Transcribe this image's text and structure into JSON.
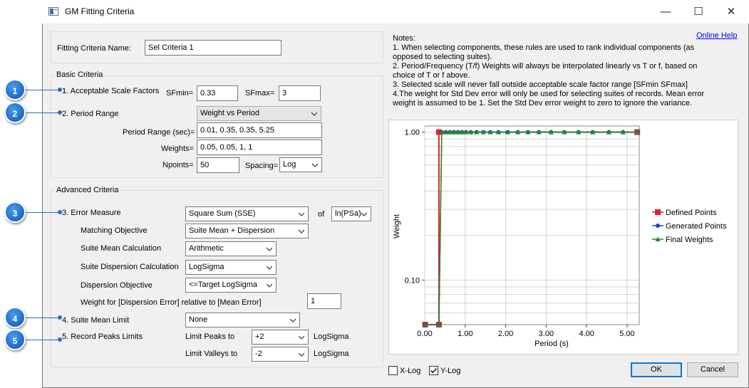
{
  "window": {
    "title": "GM Fitting Criteria",
    "minimize_glyph": "—",
    "maximize_glyph": "☐",
    "close_glyph": "✕"
  },
  "fitting_criteria_name": {
    "label": "Fitting Criteria Name:",
    "value": "Sel Criteria 1"
  },
  "basic": {
    "title": "Basic Criteria",
    "scale_factors_label": "1. Acceptable Scale Factors",
    "sfmin_label": "SFmin=",
    "sfmin_value": "0.33",
    "sfmax_label": "SFmax=",
    "sfmax_value": "3",
    "period_range_label": "2. Period Range",
    "period_mode": "Weight vs Period",
    "period_range_sec_label": "Period Range (sec)=",
    "period_range_sec_value": "0.01, 0.35, 0.35, 5.25",
    "weights_label": "Weights=",
    "weights_value": "0.05, 0.05, 1, 1",
    "npoints_label": "Npoints=",
    "npoints_value": "50",
    "spacing_label": "Spacing=",
    "spacing_value": "Log"
  },
  "advanced": {
    "title": "Advanced Criteria",
    "error_measure_label": "3. Error Measure",
    "error_measure_value": "Square Sum (SSE)",
    "of_label": "of",
    "of_value": "ln(PSa)",
    "matching_objective_label": "Matching Objective",
    "matching_objective_value": "Suite Mean + Dispersion",
    "suite_mean_calc_label": "Suite Mean Calculation",
    "suite_mean_calc_value": "Arithmetic",
    "suite_disp_calc_label": "Suite Dispersion Calculation",
    "suite_disp_calc_value": "LogSigma",
    "dispersion_objective_label": "Dispersion Objective",
    "dispersion_objective_value": "<=Target LogSigma",
    "weight_disp_label": "Weight for [Dispersion Error] relative to [Mean Error]",
    "weight_disp_value": "1",
    "suite_mean_limit_label": "4. Suite Mean Limit",
    "suite_mean_limit_value": "None",
    "record_peaks_label": "5. Record Peaks Limits",
    "limit_peaks_label": "Limit Peaks to",
    "limit_peaks_value": "+2",
    "limit_peaks_unit": "LogSigma",
    "limit_valleys_label": "Limit Valleys to",
    "limit_valleys_value": "-2",
    "limit_valleys_unit": "LogSigma"
  },
  "callouts": [
    "1",
    "2",
    "3",
    "4",
    "5"
  ],
  "notes": {
    "title": "Notes:",
    "lines": [
      "1. When selecting components, these rules are used to rank individual components (as",
      "opposed to selecting suites).",
      "2. Period/Frequency (T/f) Weights will always be interpolated linearly vs T or f, based on",
      "choice of T or f above.",
      "3. Selected scale will never fall outside acceptable scale factor range [SFmin SFmax]",
      "4.The weight for Std Dev error will only be used for selecting suites of records. Mean error",
      "weight is assumed to be 1. Set the Std Dev error weight to zero to ignore the variance."
    ],
    "help_link": "Online Help"
  },
  "options": {
    "xlog_label": "X-Log",
    "xlog_checked": false,
    "ylog_label": "Y-Log",
    "ylog_checked": true
  },
  "buttons": {
    "ok": "OK",
    "cancel": "Cancel"
  },
  "chart_data": {
    "type": "line",
    "xlabel": "Period (s)",
    "ylabel": "Weight",
    "xlim": [
      0,
      5.3
    ],
    "ylim": [
      0.05,
      1.1
    ],
    "yscale": "log",
    "xticks": [
      0,
      1,
      2,
      3,
      4,
      5
    ],
    "xtick_labels": [
      "0.00",
      "1.00",
      "2.00",
      "3.00",
      "4.00",
      "5.00"
    ],
    "yticks": [
      0.1,
      1.0
    ],
    "ytick_labels": [
      "0.10",
      "1.00"
    ],
    "grid": true,
    "legend_position": "right",
    "series": [
      {
        "name": "Defined Points",
        "color": "#e8202a",
        "marker": "square",
        "x": [
          0.01,
          0.35,
          0.35,
          5.25
        ],
        "y": [
          0.05,
          0.05,
          1,
          1
        ]
      },
      {
        "name": "Generated Points",
        "color": "#1f3fd6",
        "marker": "circle",
        "x": [
          0.01,
          0.35,
          0.42,
          0.52,
          0.62,
          0.72,
          0.82,
          0.92,
          1.02,
          1.14,
          1.28,
          1.45,
          1.62,
          1.82,
          2.05,
          2.3,
          2.55,
          2.82,
          3.12,
          3.45,
          3.8,
          4.15,
          4.55,
          4.9,
          5.25
        ],
        "y": [
          0.05,
          0.05,
          1,
          1,
          1,
          1,
          1,
          1,
          1,
          1,
          1,
          1,
          1,
          1,
          1,
          1,
          1,
          1,
          1,
          1,
          1,
          1,
          1,
          1,
          1
        ]
      },
      {
        "name": "Final Weights",
        "color": "#1f8a2a",
        "marker": "triangle",
        "x": [
          0.01,
          0.35,
          0.42,
          0.52,
          0.62,
          0.72,
          0.82,
          0.92,
          1.02,
          1.14,
          1.28,
          1.45,
          1.62,
          1.82,
          2.05,
          2.3,
          2.55,
          2.82,
          3.12,
          3.45,
          3.8,
          4.15,
          4.55,
          4.9,
          5.25
        ],
        "y": [
          0.05,
          0.05,
          1,
          1,
          1,
          1,
          1,
          1,
          1,
          1,
          1,
          1,
          1,
          1,
          1,
          1,
          1,
          1,
          1,
          1,
          1,
          1,
          1,
          1,
          1
        ]
      }
    ]
  }
}
